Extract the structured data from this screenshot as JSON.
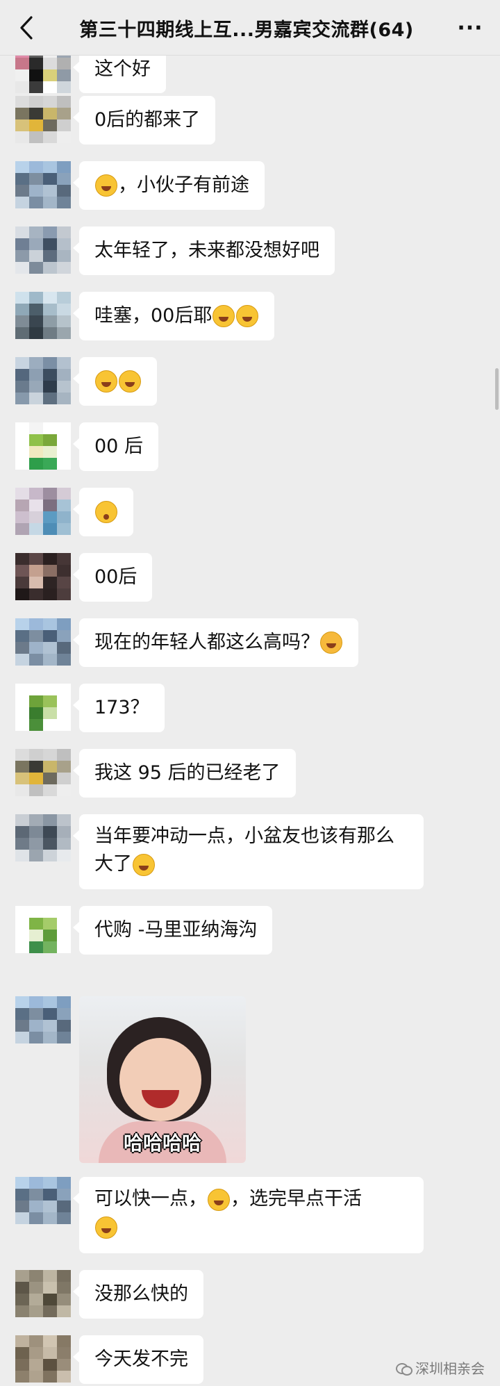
{
  "header": {
    "title": "第三十四期线上互...男嘉宾交流群(64)",
    "back_icon": "chevron-left-icon",
    "more_label": "···"
  },
  "messages": [
    {
      "text": "这个好",
      "avatar": [
        "#e08aa8",
        "#5e5e5e",
        "#efefef",
        "#9aa4b0",
        "#c7778a",
        "#2a2a2a",
        "#dcdcdc",
        "#b0b0b0",
        "#f0f0f0",
        "#111111",
        "#d9d07a",
        "#8f9aa6",
        "#e8e8e8",
        "#3b3b3b",
        "#ffffff",
        "#cfd6dc"
      ]
    },
    {
      "text": "0后的都来了",
      "avatar": [
        "#dcdcdc",
        "#cfcfcf",
        "#d6d6d6",
        "#bfbfbf",
        "#7a7560",
        "#3a3a35",
        "#c9b66a",
        "#a8a18a",
        "#d8c27a",
        "#e1b53a",
        "#6d6a5e",
        "#cfcfcf",
        "#e8e8e8",
        "#c0c0c0",
        "#d9d9d9",
        "#eeeeee"
      ]
    },
    {
      "text": "，小伙子有前途",
      "emoji_before": true,
      "avatar": [
        "#b8d2ea",
        "#9cb9da",
        "#a9c5e0",
        "#7e9ec0",
        "#5a6f85",
        "#7d8ea0",
        "#4a5f78",
        "#8aa2bb",
        "#6c7a8a",
        "#9eb3c9",
        "#b0c2d3",
        "#58697c",
        "#c5d3e0",
        "#7b8ea3",
        "#a3b6c8",
        "#6f8398"
      ]
    },
    {
      "text": "太年轻了，未来都没想好吧",
      "avatar": [
        "#d8dde3",
        "#a7b4c2",
        "#8a9bb0",
        "#c3c9d0",
        "#6f7f94",
        "#9aa9ba",
        "#3f4f62",
        "#b5bfca",
        "#8c9aa9",
        "#cbd2d9",
        "#5d6c7e",
        "#a9b5c1",
        "#e3e6ea",
        "#7d8b9a",
        "#bcc5ce",
        "#d0d5db"
      ]
    },
    {
      "text": "哇塞，00后耶",
      "emoji_after": 2,
      "avatar": [
        "#cfe1ec",
        "#9fb9c9",
        "#d8e6ef",
        "#b8cdd9",
        "#8fa8b7",
        "#4c5e6a",
        "#a7bdca",
        "#c9d9e3",
        "#7f8c96",
        "#3a4650",
        "#8e9da6",
        "#b6c3cb",
        "#5f6c74",
        "#2f3a42",
        "#6f7c84",
        "#9aa6ad"
      ]
    },
    {
      "text": "",
      "emoji_after": 2,
      "avatar": [
        "#c8d4e0",
        "#9cadbf",
        "#7b8fa5",
        "#b3c1cf",
        "#54677d",
        "#8d9fb2",
        "#3c4d60",
        "#a2b1c0",
        "#6a7b8d",
        "#98a8b8",
        "#2e3c4b",
        "#b7c3ce",
        "#8799ab",
        "#c9d3dc",
        "#5e6f80",
        "#a6b4c1"
      ]
    },
    {
      "text": "00 后",
      "avatar": [
        "#ffffff",
        "#f4f4f4",
        "#ffffff",
        "#ffffff",
        "#ffffff",
        "#8fc14a",
        "#7aa83a",
        "#ffffff",
        "#ffffff",
        "#f0e9c0",
        "#e9f0d0",
        "#ffffff",
        "#ffffff",
        "#2e9e4a",
        "#3aa957",
        "#ffffff"
      ]
    },
    {
      "text": "",
      "emoji_wow": true,
      "avatar": [
        "#e4dde6",
        "#c7b8c9",
        "#9d8ea0",
        "#d5cbd6",
        "#b7a6b3",
        "#e8e1ea",
        "#7c6f80",
        "#a7c3d6",
        "#cdbfce",
        "#d7d0da",
        "#5c9bc2",
        "#8fb3cb",
        "#b0a4b3",
        "#c5d8e5",
        "#4e8db6",
        "#9fbfd3"
      ]
    },
    {
      "text": "00后",
      "avatar": [
        "#3a2d2d",
        "#5b4646",
        "#2b2020",
        "#463636",
        "#6e5555",
        "#c4a08f",
        "#8a6e64",
        "#3d2f2f",
        "#4a3a3a",
        "#d8bcae",
        "#2e2424",
        "#584545",
        "#1f1818",
        "#3a2d2d",
        "#2a2020",
        "#4d3d3d"
      ]
    },
    {
      "text": "现在的年轻人都这么高吗？",
      "emoji_six": true,
      "avatar": [
        "#b8d2ea",
        "#9cb9da",
        "#a9c5e0",
        "#7e9ec0",
        "#5a6f85",
        "#7d8ea0",
        "#4a5f78",
        "#8aa2bb",
        "#6c7a8a",
        "#9eb3c9",
        "#b0c2d3",
        "#58697c",
        "#c5d3e0",
        "#7b8ea3",
        "#a3b6c8",
        "#6f8398"
      ]
    },
    {
      "text": "173？",
      "avatar": [
        "#ffffff",
        "#ffffff",
        "#ffffff",
        "#ffffff",
        "#ffffff",
        "#6ea33a",
        "#9ac25a",
        "#ffffff",
        "#ffffff",
        "#3a7d2e",
        "#c9dfa7",
        "#ffffff",
        "#ffffff",
        "#4b8f3a",
        "#ffffff",
        "#ffffff"
      ]
    },
    {
      "text": "我这 95 后的已经老了",
      "avatar": [
        "#dcdcdc",
        "#cfcfcf",
        "#d6d6d6",
        "#bfbfbf",
        "#7a7560",
        "#3a3a35",
        "#c9b66a",
        "#a8a18a",
        "#d8c27a",
        "#e1b53a",
        "#6d6a5e",
        "#cfcfcf",
        "#e8e8e8",
        "#c0c0c0",
        "#d9d9d9",
        "#eeeeee"
      ]
    },
    {
      "text": "当年要冲动一点，小盆友也该有那么大了",
      "emoji_after": 1,
      "avatar": [
        "#c9ced4",
        "#a2abb5",
        "#8a96a3",
        "#bcc3cb",
        "#5c6875",
        "#7d8996",
        "#3e4955",
        "#a6afb9",
        "#6f7b88",
        "#8e99a5",
        "#4b5662",
        "#b1bac3",
        "#dfe3e7",
        "#9ba5af",
        "#cdd3d9",
        "#e7eaed"
      ]
    },
    {
      "text": "代购 -马里亚纳海沟",
      "avatar": [
        "#ffffff",
        "#ffffff",
        "#ffffff",
        "#ffffff",
        "#ffffff",
        "#7fb446",
        "#a5cc6a",
        "#ffffff",
        "#ffffff",
        "#e6efd2",
        "#5e9c3a",
        "#ffffff",
        "#ffffff",
        "#3e8f4a",
        "#73b35f",
        "#ffffff"
      ]
    },
    {
      "text": "",
      "gif_caption": "哈哈哈哈",
      "avatar": [
        "#b8d2ea",
        "#9cb9da",
        "#a9c5e0",
        "#7e9ec0",
        "#5a6f85",
        "#7d8ea0",
        "#4a5f78",
        "#8aa2bb",
        "#6c7a8a",
        "#9eb3c9",
        "#b0c2d3",
        "#58697c",
        "#c5d3e0",
        "#7b8ea3",
        "#a3b6c8",
        "#6f8398"
      ]
    },
    {
      "text": "可以快一点，",
      "text2": "，选完早点干活",
      "emoji_mid": true,
      "emoji_end": true,
      "avatar": [
        "#b8d2ea",
        "#9cb9da",
        "#a9c5e0",
        "#7e9ec0",
        "#5a6f85",
        "#7d8ea0",
        "#4a5f78",
        "#8aa2bb",
        "#6c7a8a",
        "#9eb3c9",
        "#b0c2d3",
        "#58697c",
        "#c5d3e0",
        "#7b8ea3",
        "#a3b6c8",
        "#6f8398"
      ]
    },
    {
      "text": "没那么快的",
      "avatar": [
        "#a8a08e",
        "#8c8472",
        "#bdb5a2",
        "#766e5e",
        "#5d5648",
        "#9b9381",
        "#c9c1ae",
        "#7f7766",
        "#6c6555",
        "#b3ab98",
        "#4f4939",
        "#958d7b",
        "#8a8270",
        "#a69e8b",
        "#736b5b",
        "#c0b8a5"
      ]
    },
    {
      "text": "今天发不完",
      "avatar": [
        "#bfb29e",
        "#9e917d",
        "#d1c5b2",
        "#867965",
        "#6e624f",
        "#a89b87",
        "#c7bba8",
        "#8b7e6b",
        "#7a6d5a",
        "#b5a894",
        "#5d5140",
        "#9a8d7a",
        "#8d806c",
        "#afa28e",
        "#7f725f",
        "#cabead"
      ]
    }
  ],
  "watermark": {
    "text": "深圳相亲会",
    "icon": "wechat-icon"
  }
}
